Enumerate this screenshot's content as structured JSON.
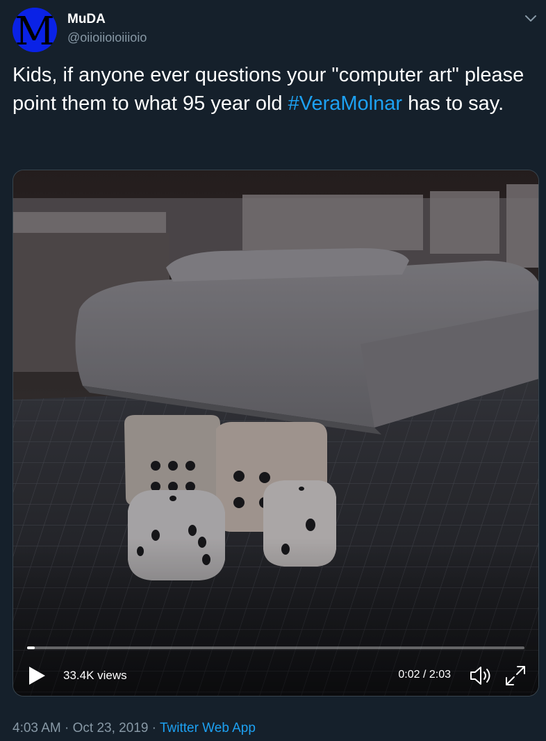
{
  "author": {
    "display_name": "MuDA",
    "handle": "@oiioiioioiiioio",
    "avatar_letter": "M",
    "avatar_color": "#0a22e6"
  },
  "tweet": {
    "text_before": "Kids, if anyone ever questions your \"computer art\" please point them to what 95 year old ",
    "hashtag": "#VeraMolnar",
    "text_after": " has to say."
  },
  "video": {
    "views": "33.4K views",
    "timecode": "0:02 / 2:03",
    "progress_fraction": 0.016
  },
  "meta": {
    "time": "4:03 AM",
    "separator1": " · ",
    "date": "Oct 23, 2019",
    "separator2": " · ",
    "source": "Twitter Web App"
  },
  "colors": {
    "background": "#15202b",
    "link": "#1da1f2",
    "secondary_text": "#8899a6"
  },
  "icons": [
    "chevron-down-icon",
    "play-icon",
    "volume-icon",
    "fullscreen-icon"
  ]
}
